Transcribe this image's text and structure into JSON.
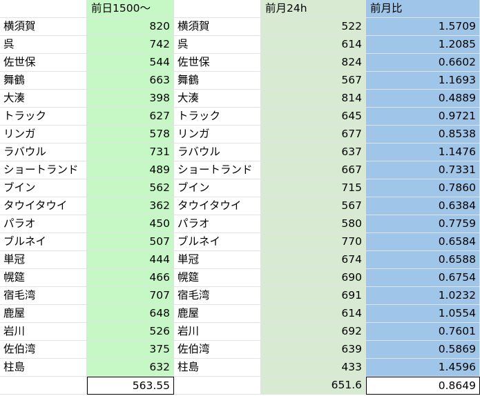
{
  "colors": {
    "col_b_fill": "#c6f8c6",
    "col_d_fill": "#d9ead3",
    "col_e_fill": "#9fc5e8",
    "gridline": "#e2e3e3"
  },
  "headers": {
    "col_a": "",
    "col_b": "前日1500～",
    "col_c": "",
    "col_d": "前月24h",
    "col_e": "前月比"
  },
  "rows": [
    {
      "name": "横須賀",
      "prev_day": "820",
      "name2": "横須賀",
      "prev_month": "522",
      "ratio": "1.5709"
    },
    {
      "name": "呉",
      "prev_day": "742",
      "name2": "呉",
      "prev_month": "614",
      "ratio": "1.2085"
    },
    {
      "name": "佐世保",
      "prev_day": "544",
      "name2": "佐世保",
      "prev_month": "824",
      "ratio": "0.6602"
    },
    {
      "name": "舞鶴",
      "prev_day": "663",
      "name2": "舞鶴",
      "prev_month": "567",
      "ratio": "1.1693"
    },
    {
      "name": "大湊",
      "prev_day": "398",
      "name2": "大湊",
      "prev_month": "814",
      "ratio": "0.4889"
    },
    {
      "name": "トラック",
      "prev_day": "627",
      "name2": "トラック",
      "prev_month": "645",
      "ratio": "0.9721"
    },
    {
      "name": "リンガ",
      "prev_day": "578",
      "name2": "リンガ",
      "prev_month": "677",
      "ratio": "0.8538"
    },
    {
      "name": "ラバウル",
      "prev_day": "731",
      "name2": "ラバウル",
      "prev_month": "637",
      "ratio": "1.1476"
    },
    {
      "name": "ショートランド",
      "prev_day": "489",
      "name2": "ショートランド",
      "prev_month": "667",
      "ratio": "0.7331"
    },
    {
      "name": "ブイン",
      "prev_day": "562",
      "name2": "ブイン",
      "prev_month": "715",
      "ratio": "0.7860"
    },
    {
      "name": "タウイタウイ",
      "prev_day": "362",
      "name2": "タウイタウイ",
      "prev_month": "567",
      "ratio": "0.6384"
    },
    {
      "name": "パラオ",
      "prev_day": "450",
      "name2": "パラオ",
      "prev_month": "580",
      "ratio": "0.7759"
    },
    {
      "name": "ブルネイ",
      "prev_day": "507",
      "name2": "ブルネイ",
      "prev_month": "770",
      "ratio": "0.6584"
    },
    {
      "name": "単冠",
      "prev_day": "444",
      "name2": "単冠",
      "prev_month": "674",
      "ratio": "0.6588"
    },
    {
      "name": "幌筵",
      "prev_day": "466",
      "name2": "幌筵",
      "prev_month": "690",
      "ratio": "0.6754"
    },
    {
      "name": "宿毛湾",
      "prev_day": "707",
      "name2": "宿毛湾",
      "prev_month": "691",
      "ratio": "1.0232"
    },
    {
      "name": "鹿屋",
      "prev_day": "648",
      "name2": "鹿屋",
      "prev_month": "614",
      "ratio": "1.0554"
    },
    {
      "name": "岩川",
      "prev_day": "526",
      "name2": "岩川",
      "prev_month": "692",
      "ratio": "0.7601"
    },
    {
      "name": "佐伯湾",
      "prev_day": "375",
      "name2": "佐伯湾",
      "prev_month": "639",
      "ratio": "0.5869"
    },
    {
      "name": "柱島",
      "prev_day": "632",
      "name2": "柱島",
      "prev_month": "433",
      "ratio": "1.4596"
    }
  ],
  "footer": {
    "col_a": "",
    "col_b": "563.55",
    "col_c": "",
    "col_d": "651.6",
    "col_e": "0.8649"
  }
}
